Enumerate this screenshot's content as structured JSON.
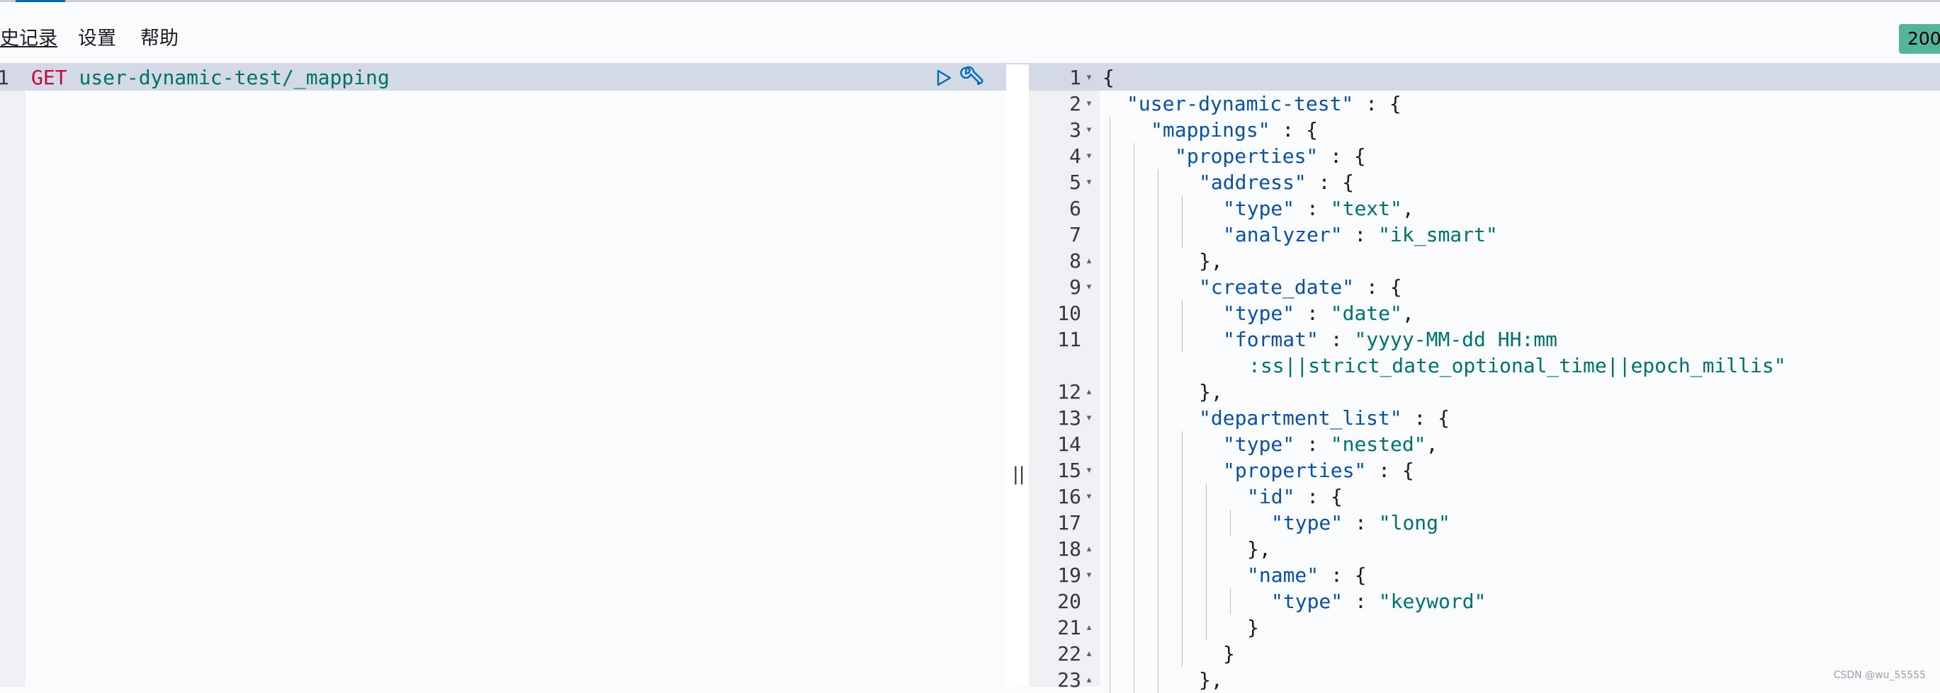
{
  "menu": {
    "history_label": "史记录",
    "settings_label": "设置",
    "help_label": "帮助"
  },
  "status_badge": "200",
  "request": {
    "line_number": "1",
    "method": "GET",
    "url": "user-dynamic-test/_mapping"
  },
  "icons": {
    "run": "play-icon",
    "tools": "wrench-icon",
    "splitter": "double-bar-icon"
  },
  "splitter_glyph": "||",
  "response": {
    "lines": [
      {
        "n": "1",
        "fold": "▾",
        "depth": 0,
        "parts": [
          {
            "t": "{",
            "c": "punc"
          }
        ]
      },
      {
        "n": "2",
        "fold": "▾",
        "depth": 1,
        "parts": [
          {
            "t": "\"user-dynamic-test\"",
            "c": "key"
          },
          {
            "t": " : {",
            "c": "punc"
          }
        ]
      },
      {
        "n": "3",
        "fold": "▾",
        "depth": 2,
        "parts": [
          {
            "t": "\"mappings\"",
            "c": "key"
          },
          {
            "t": " : {",
            "c": "punc"
          }
        ]
      },
      {
        "n": "4",
        "fold": "▾",
        "depth": 3,
        "parts": [
          {
            "t": "\"properties\"",
            "c": "key"
          },
          {
            "t": " : {",
            "c": "punc"
          }
        ]
      },
      {
        "n": "5",
        "fold": "▾",
        "depth": 4,
        "parts": [
          {
            "t": "\"address\"",
            "c": "key"
          },
          {
            "t": " : {",
            "c": "punc"
          }
        ]
      },
      {
        "n": "6",
        "fold": "",
        "depth": 5,
        "parts": [
          {
            "t": "\"type\"",
            "c": "key"
          },
          {
            "t": " : ",
            "c": "punc"
          },
          {
            "t": "\"text\"",
            "c": "str"
          },
          {
            "t": ",",
            "c": "punc"
          }
        ]
      },
      {
        "n": "7",
        "fold": "",
        "depth": 5,
        "parts": [
          {
            "t": "\"analyzer\"",
            "c": "key"
          },
          {
            "t": " : ",
            "c": "punc"
          },
          {
            "t": "\"ik_smart\"",
            "c": "str"
          }
        ]
      },
      {
        "n": "8",
        "fold": "▴",
        "depth": 4,
        "parts": [
          {
            "t": "},",
            "c": "punc"
          }
        ]
      },
      {
        "n": "9",
        "fold": "▾",
        "depth": 4,
        "parts": [
          {
            "t": "\"create_date\"",
            "c": "key"
          },
          {
            "t": " : {",
            "c": "punc"
          }
        ]
      },
      {
        "n": "10",
        "fold": "",
        "depth": 5,
        "parts": [
          {
            "t": "\"type\"",
            "c": "key"
          },
          {
            "t": " : ",
            "c": "punc"
          },
          {
            "t": "\"date\"",
            "c": "str"
          },
          {
            "t": ",",
            "c": "punc"
          }
        ]
      },
      {
        "n": "11",
        "fold": "",
        "depth": 5,
        "parts": [
          {
            "t": "\"format\"",
            "c": "key"
          },
          {
            "t": " : ",
            "c": "punc"
          },
          {
            "t": "\"yyyy-MM-dd HH:mm",
            "c": "str"
          }
        ]
      },
      {
        "n": "",
        "fold": "",
        "depth": 4,
        "cont": true,
        "parts": [
          {
            "t": ":ss||strict_date_optional_time||epoch_millis\"",
            "c": "str"
          }
        ]
      },
      {
        "n": "12",
        "fold": "▴",
        "depth": 4,
        "parts": [
          {
            "t": "},",
            "c": "punc"
          }
        ]
      },
      {
        "n": "13",
        "fold": "▾",
        "depth": 4,
        "parts": [
          {
            "t": "\"department_list\"",
            "c": "key"
          },
          {
            "t": " : {",
            "c": "punc"
          }
        ]
      },
      {
        "n": "14",
        "fold": "",
        "depth": 5,
        "parts": [
          {
            "t": "\"type\"",
            "c": "key"
          },
          {
            "t": " : ",
            "c": "punc"
          },
          {
            "t": "\"nested\"",
            "c": "str"
          },
          {
            "t": ",",
            "c": "punc"
          }
        ]
      },
      {
        "n": "15",
        "fold": "▾",
        "depth": 5,
        "parts": [
          {
            "t": "\"properties\"",
            "c": "key"
          },
          {
            "t": " : {",
            "c": "punc"
          }
        ]
      },
      {
        "n": "16",
        "fold": "▾",
        "depth": 6,
        "parts": [
          {
            "t": "\"id\"",
            "c": "key"
          },
          {
            "t": " : {",
            "c": "punc"
          }
        ]
      },
      {
        "n": "17",
        "fold": "",
        "depth": 7,
        "parts": [
          {
            "t": "\"type\"",
            "c": "key"
          },
          {
            "t": " : ",
            "c": "punc"
          },
          {
            "t": "\"long\"",
            "c": "str"
          }
        ]
      },
      {
        "n": "18",
        "fold": "▴",
        "depth": 6,
        "parts": [
          {
            "t": "},",
            "c": "punc"
          }
        ]
      },
      {
        "n": "19",
        "fold": "▾",
        "depth": 6,
        "parts": [
          {
            "t": "\"name\"",
            "c": "key"
          },
          {
            "t": " : {",
            "c": "punc"
          }
        ]
      },
      {
        "n": "20",
        "fold": "",
        "depth": 7,
        "parts": [
          {
            "t": "\"type\"",
            "c": "key"
          },
          {
            "t": " : ",
            "c": "punc"
          },
          {
            "t": "\"keyword\"",
            "c": "str"
          }
        ]
      },
      {
        "n": "21",
        "fold": "▴",
        "depth": 6,
        "parts": [
          {
            "t": "}",
            "c": "punc"
          }
        ]
      },
      {
        "n": "22",
        "fold": "▴",
        "depth": 5,
        "parts": [
          {
            "t": "}",
            "c": "punc"
          }
        ]
      },
      {
        "n": "23",
        "fold": "▴",
        "depth": 4,
        "parts": [
          {
            "t": "},",
            "c": "punc"
          }
        ]
      }
    ]
  },
  "watermark": "CSDN @wu_55555"
}
